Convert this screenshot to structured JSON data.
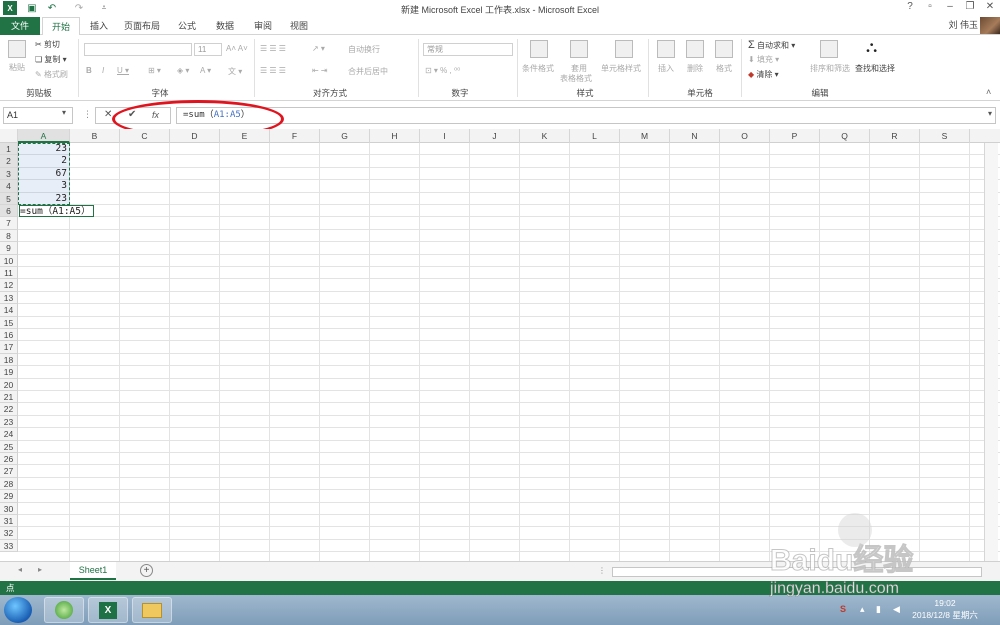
{
  "window": {
    "title": "新建 Microsoft Excel 工作表.xlsx - Microsoft Excel",
    "user": "刘 伟玉"
  },
  "ribbon_tabs": [
    "文件",
    "开始",
    "插入",
    "页面布局",
    "公式",
    "数据",
    "审阅",
    "视图"
  ],
  "ribbon": {
    "clipboard": {
      "paste": "粘贴",
      "cut": "剪切",
      "copy": "复制",
      "format_painter": "格式刷",
      "label": "剪贴板"
    },
    "font": {
      "name": "",
      "size": "11",
      "label": "字体"
    },
    "alignment": {
      "wrap": "自动换行",
      "merge": "合并后居中",
      "label": "对齐方式"
    },
    "number": {
      "format": "常规",
      "label": "数字"
    },
    "styles": {
      "conditional": "条件格式",
      "table": "套用",
      "table2": "表格格式",
      "cell_styles": "单元格样式",
      "label": "样式"
    },
    "cells": {
      "insert": "插入",
      "delete": "删除",
      "format": "格式",
      "label": "单元格"
    },
    "editing": {
      "autosum": "自动求和",
      "fill": "填充",
      "clear": "清除",
      "sort": "排序和筛选",
      "find": "查找和选择",
      "label": "编辑"
    }
  },
  "formula_bar": {
    "name_box": "A1",
    "fx": "fx",
    "formula_prefix": "=sum（",
    "formula_ref": "A1:A5",
    "formula_suffix": "）"
  },
  "columns": [
    "A",
    "B",
    "C",
    "D",
    "E",
    "F",
    "G",
    "H",
    "I",
    "J",
    "K",
    "L",
    "M",
    "N",
    "O",
    "P",
    "Q",
    "R",
    "S"
  ],
  "rows": [
    "1",
    "2",
    "3",
    "4",
    "5",
    "6",
    "7",
    "8",
    "9",
    "10",
    "11",
    "12",
    "13",
    "14",
    "15",
    "16",
    "17",
    "18",
    "19",
    "20",
    "21",
    "22",
    "23",
    "24",
    "25",
    "26",
    "27",
    "28",
    "29",
    "30",
    "31",
    "32",
    "33"
  ],
  "cells": {
    "A1": "23",
    "A2": "2",
    "A3": "67",
    "A4": "3",
    "A5": "23",
    "A6": "=sum（A1:A5）"
  },
  "sheet_tabs": [
    "Sheet1"
  ],
  "status": "点",
  "taskbar": {
    "time": "19:02",
    "date": "2018/12/8 星期六"
  },
  "watermark": {
    "brand": "Baidu经验",
    "url": "jingyan.baidu.com"
  },
  "colors": {
    "excel_green": "#217346",
    "highlight_red": "#e0141e",
    "ref_blue": "#4472c4"
  }
}
